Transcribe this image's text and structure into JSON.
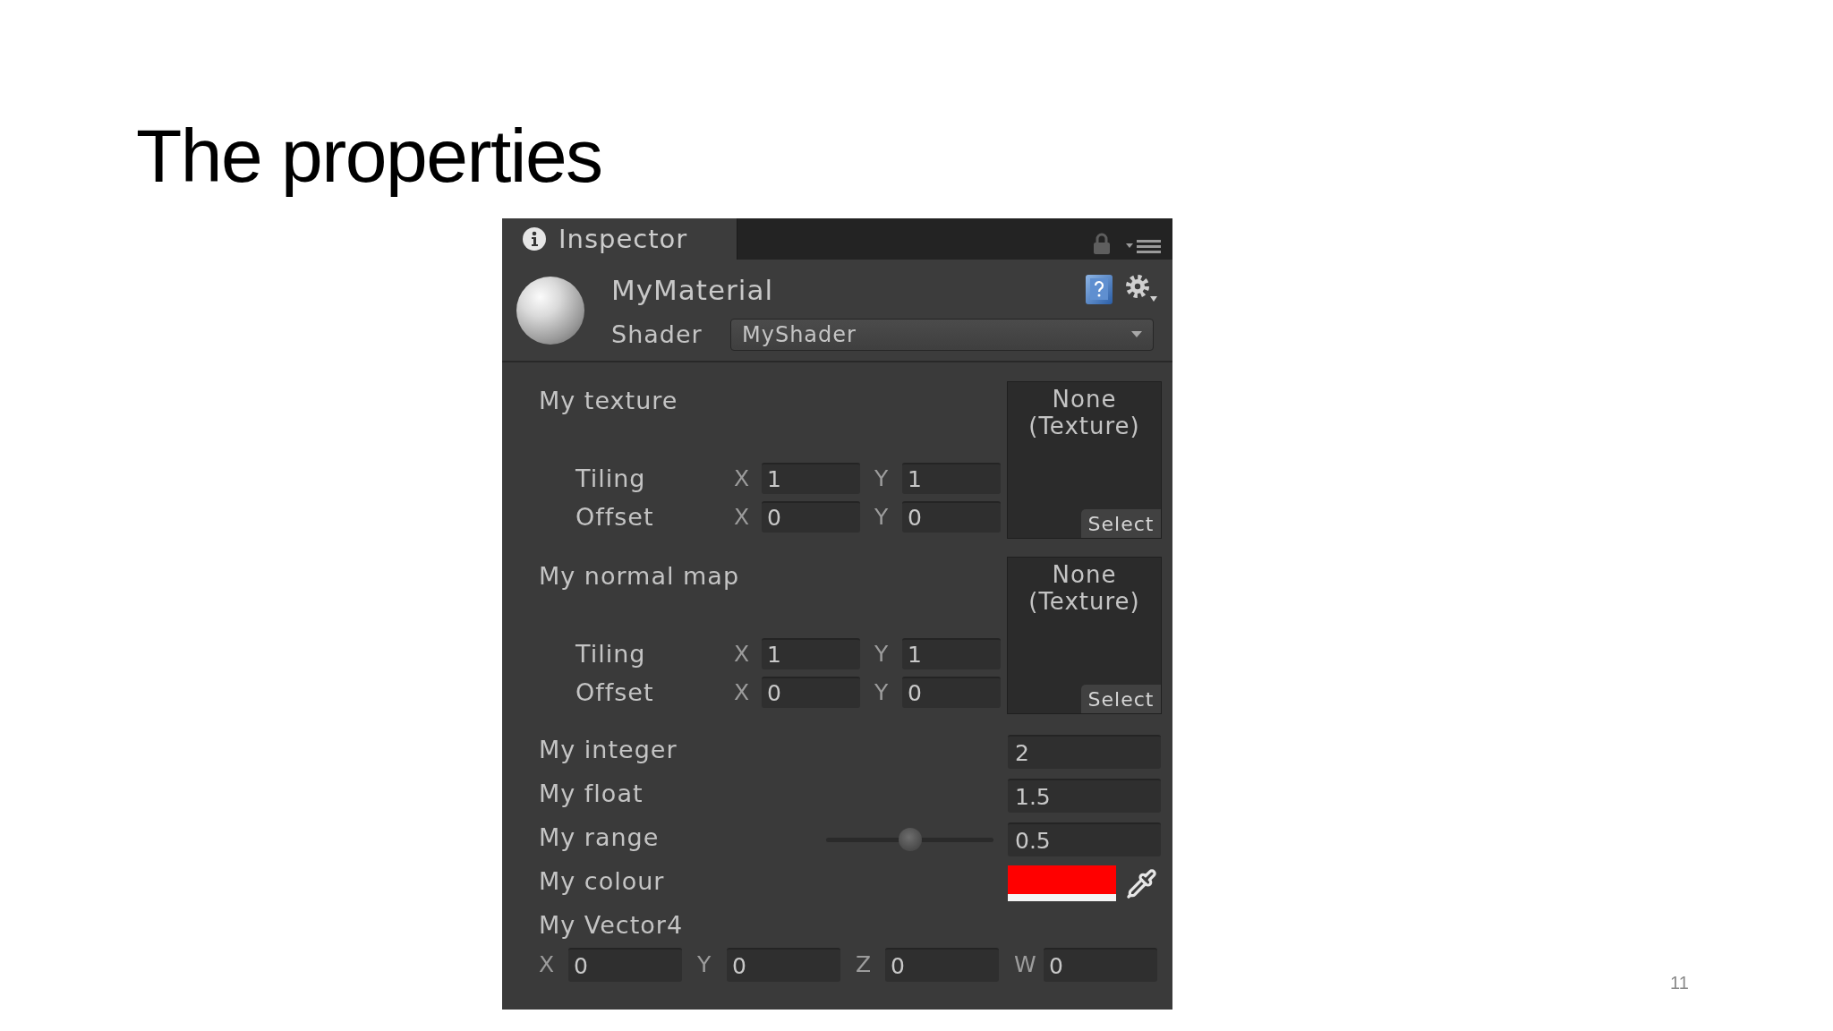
{
  "slide": {
    "title": "The properties",
    "page_number": "11"
  },
  "inspector": {
    "tab": {
      "label": "Inspector",
      "selected": true
    },
    "material": {
      "name": "MyMaterial",
      "shader_label": "Shader",
      "shader": "MyShader"
    },
    "properties": [
      {
        "kind": "texture",
        "label": "My texture",
        "slot_text": "None (Texture)",
        "select_label": "Select",
        "rows": [
          {
            "label": "Tiling",
            "fields": [
              {
                "axis": "X",
                "value": "1"
              },
              {
                "axis": "Y",
                "value": "1"
              }
            ]
          },
          {
            "label": "Offset",
            "fields": [
              {
                "axis": "X",
                "value": "0"
              },
              {
                "axis": "Y",
                "value": "0"
              }
            ]
          }
        ]
      },
      {
        "kind": "texture",
        "label": "My normal map",
        "slot_text": "None (Texture)",
        "select_label": "Select",
        "rows": [
          {
            "label": "Tiling",
            "fields": [
              {
                "axis": "X",
                "value": "1"
              },
              {
                "axis": "Y",
                "value": "1"
              }
            ]
          },
          {
            "label": "Offset",
            "fields": [
              {
                "axis": "X",
                "value": "0"
              },
              {
                "axis": "Y",
                "value": "0"
              }
            ]
          }
        ]
      },
      {
        "kind": "number",
        "label": "My integer",
        "value": "2"
      },
      {
        "kind": "number",
        "label": "My float",
        "value": "1.5"
      },
      {
        "kind": "range",
        "label": "My range",
        "level": 0.5,
        "value": "0.5"
      },
      {
        "kind": "color",
        "label": "My colour",
        "color": "#ff0000"
      },
      {
        "kind": "vector",
        "label": "My Vector4",
        "fields": [
          {
            "axis": "X",
            "value": "0"
          },
          {
            "axis": "Y",
            "value": "0"
          },
          {
            "axis": "Z",
            "value": "0"
          },
          {
            "axis": "W",
            "value": "0"
          }
        ]
      }
    ]
  }
}
